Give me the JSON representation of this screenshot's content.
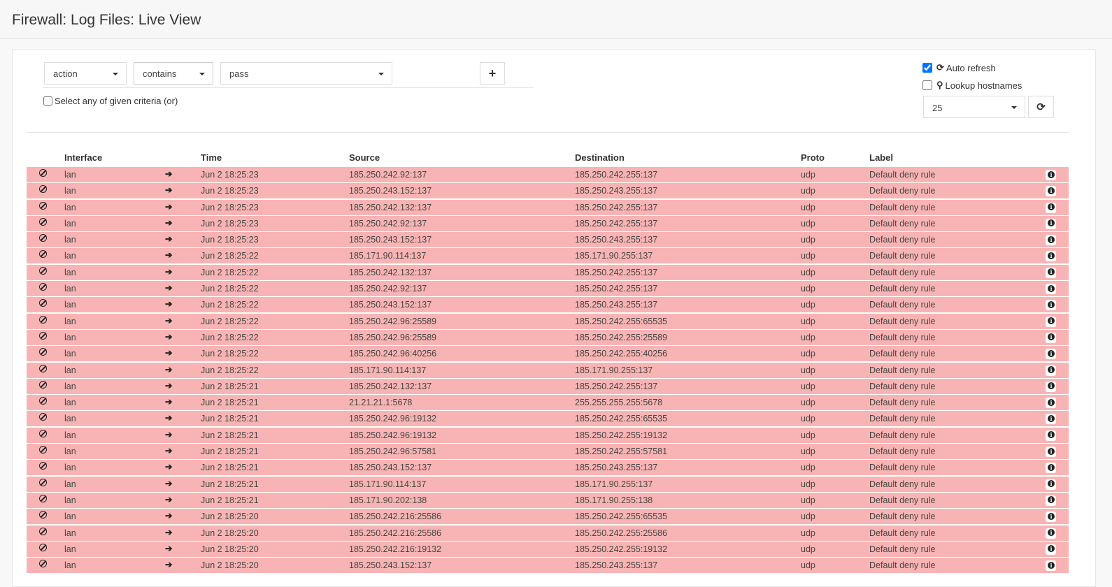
{
  "header": {
    "title": "Firewall: Log Files: Live View"
  },
  "filter": {
    "field": "action",
    "operator": "contains",
    "value": "pass",
    "add_icon": "plus-icon",
    "or_label": "Select any of given criteria (or)",
    "or_checked": false
  },
  "controls": {
    "auto_refresh_label": "Auto refresh",
    "auto_refresh_checked": true,
    "auto_refresh_icon": "refresh-icon",
    "lookup_label": "Lookup hostnames",
    "lookup_checked": false,
    "lookup_icon": "search-icon",
    "limit": "25",
    "refresh_icon": "refresh-icon"
  },
  "table": {
    "columns": [
      "Interface",
      "Time",
      "Source",
      "Destination",
      "Proto",
      "Label"
    ],
    "row_color": "#f8b4b4",
    "rows": [
      {
        "iface": "lan",
        "time": "Jun 2 18:25:23",
        "src": "185.250.242.92:137",
        "dst": "185.250.242.255:137",
        "proto": "udp",
        "label": "Default deny rule"
      },
      {
        "iface": "lan",
        "time": "Jun 2 18:25:23",
        "src": "185.250.243.152:137",
        "dst": "185.250.243.255:137",
        "proto": "udp",
        "label": "Default deny rule"
      },
      {
        "iface": "lan",
        "time": "Jun 2 18:25:23",
        "src": "185.250.242.132:137",
        "dst": "185.250.242.255:137",
        "proto": "udp",
        "label": "Default deny rule"
      },
      {
        "iface": "lan",
        "time": "Jun 2 18:25:23",
        "src": "185.250.242.92:137",
        "dst": "185.250.242.255:137",
        "proto": "udp",
        "label": "Default deny rule"
      },
      {
        "iface": "lan",
        "time": "Jun 2 18:25:23",
        "src": "185.250.243.152:137",
        "dst": "185.250.243.255:137",
        "proto": "udp",
        "label": "Default deny rule"
      },
      {
        "iface": "lan",
        "time": "Jun 2 18:25:22",
        "src": "185.171.90.114:137",
        "dst": "185.171.90.255:137",
        "proto": "udp",
        "label": "Default deny rule"
      },
      {
        "iface": "lan",
        "time": "Jun 2 18:25:22",
        "src": "185.250.242.132:137",
        "dst": "185.250.242.255:137",
        "proto": "udp",
        "label": "Default deny rule"
      },
      {
        "iface": "lan",
        "time": "Jun 2 18:25:22",
        "src": "185.250.242.92:137",
        "dst": "185.250.242.255:137",
        "proto": "udp",
        "label": "Default deny rule"
      },
      {
        "iface": "lan",
        "time": "Jun 2 18:25:22",
        "src": "185.250.243.152:137",
        "dst": "185.250.243.255:137",
        "proto": "udp",
        "label": "Default deny rule"
      },
      {
        "iface": "lan",
        "time": "Jun 2 18:25:22",
        "src": "185.250.242.96:25589",
        "dst": "185.250.242.255:65535",
        "proto": "udp",
        "label": "Default deny rule"
      },
      {
        "iface": "lan",
        "time": "Jun 2 18:25:22",
        "src": "185.250.242.96:25589",
        "dst": "185.250.242.255:25589",
        "proto": "udp",
        "label": "Default deny rule"
      },
      {
        "iface": "lan",
        "time": "Jun 2 18:25:22",
        "src": "185.250.242.96:40256",
        "dst": "185.250.242.255:40256",
        "proto": "udp",
        "label": "Default deny rule"
      },
      {
        "iface": "lan",
        "time": "Jun 2 18:25:22",
        "src": "185.171.90.114:137",
        "dst": "185.171.90.255:137",
        "proto": "udp",
        "label": "Default deny rule"
      },
      {
        "iface": "lan",
        "time": "Jun 2 18:25:21",
        "src": "185.250.242.132:137",
        "dst": "185.250.242.255:137",
        "proto": "udp",
        "label": "Default deny rule"
      },
      {
        "iface": "lan",
        "time": "Jun 2 18:25:21",
        "src": "21.21.21.1:5678",
        "dst": "255.255.255.255:5678",
        "proto": "udp",
        "label": "Default deny rule"
      },
      {
        "iface": "lan",
        "time": "Jun 2 18:25:21",
        "src": "185.250.242.96:19132",
        "dst": "185.250.242.255:65535",
        "proto": "udp",
        "label": "Default deny rule"
      },
      {
        "iface": "lan",
        "time": "Jun 2 18:25:21",
        "src": "185.250.242.96:19132",
        "dst": "185.250.242.255:19132",
        "proto": "udp",
        "label": "Default deny rule"
      },
      {
        "iface": "lan",
        "time": "Jun 2 18:25:21",
        "src": "185.250.242.96:57581",
        "dst": "185.250.242.255:57581",
        "proto": "udp",
        "label": "Default deny rule"
      },
      {
        "iface": "lan",
        "time": "Jun 2 18:25:21",
        "src": "185.250.243.152:137",
        "dst": "185.250.243.255:137",
        "proto": "udp",
        "label": "Default deny rule"
      },
      {
        "iface": "lan",
        "time": "Jun 2 18:25:21",
        "src": "185.171.90.114:137",
        "dst": "185.171.90.255:137",
        "proto": "udp",
        "label": "Default deny rule"
      },
      {
        "iface": "lan",
        "time": "Jun 2 18:25:21",
        "src": "185.171.90.202:138",
        "dst": "185.171.90.255:138",
        "proto": "udp",
        "label": "Default deny rule"
      },
      {
        "iface": "lan",
        "time": "Jun 2 18:25:20",
        "src": "185.250.242.216:25586",
        "dst": "185.250.242.255:65535",
        "proto": "udp",
        "label": "Default deny rule"
      },
      {
        "iface": "lan",
        "time": "Jun 2 18:25:20",
        "src": "185.250.242.216:25586",
        "dst": "185.250.242.255:25586",
        "proto": "udp",
        "label": "Default deny rule"
      },
      {
        "iface": "lan",
        "time": "Jun 2 18:25:20",
        "src": "185.250.242.216:19132",
        "dst": "185.250.242.255:19132",
        "proto": "udp",
        "label": "Default deny rule"
      },
      {
        "iface": "lan",
        "time": "Jun 2 18:25:20",
        "src": "185.250.243.152:137",
        "dst": "185.250.243.255:137",
        "proto": "udp",
        "label": "Default deny rule"
      }
    ]
  }
}
